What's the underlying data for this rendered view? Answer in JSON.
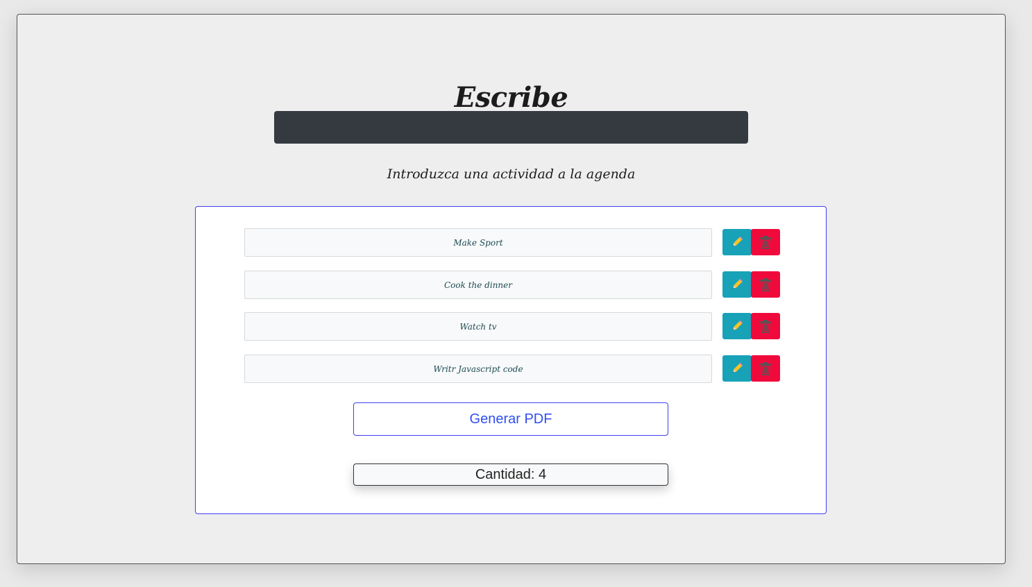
{
  "header": {
    "title": "Escribe",
    "subtitle": "Introduzca una actividad a la agenda"
  },
  "input": {
    "value": ""
  },
  "activities": [
    {
      "text": "Make Sport"
    },
    {
      "text": "Cook the dinner"
    },
    {
      "text": "Watch tv"
    },
    {
      "text": "Writr Javascript code"
    }
  ],
  "actions": {
    "pdf_label": "Generar PDF",
    "count_label": "Cantidad: 4"
  },
  "icons": {
    "edit": "pencil-icon",
    "delete": "trash-icon"
  },
  "colors": {
    "edit": "#17a2b8",
    "delete": "#f00a3c",
    "accent": "#3e3ef0",
    "input_bg": "#343a40"
  }
}
